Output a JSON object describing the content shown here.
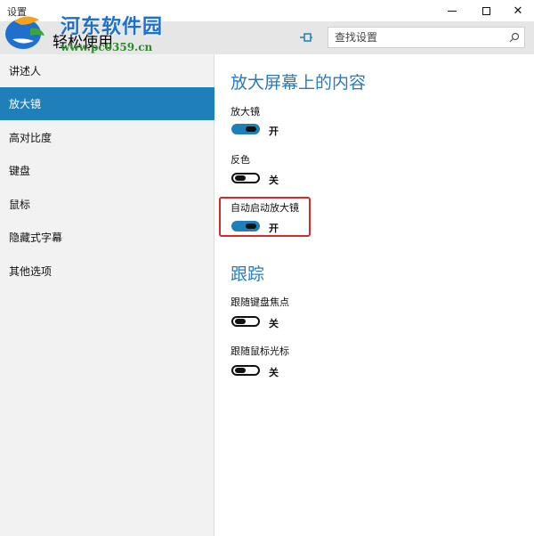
{
  "window": {
    "title": "设置",
    "controls": {
      "minimize": "minimize",
      "maximize": "maximize",
      "close": "close"
    }
  },
  "logo": {
    "text": "河东软件园",
    "url": "www.pc0359.cn"
  },
  "header": {
    "title": "轻松使用",
    "search_placeholder": "查找设置"
  },
  "sidebar": {
    "items": [
      {
        "label": "讲述人",
        "active": false
      },
      {
        "label": "放大镜",
        "active": true
      },
      {
        "label": "高对比度",
        "active": false
      },
      {
        "label": "键盘",
        "active": false
      },
      {
        "label": "鼠标",
        "active": false
      },
      {
        "label": "隐藏式字幕",
        "active": false
      },
      {
        "label": "其他选项",
        "active": false
      }
    ]
  },
  "magnifier_section": {
    "title": "放大屏幕上的内容",
    "settings": [
      {
        "label": "放大镜",
        "state": "开",
        "on": true
      },
      {
        "label": "反色",
        "state": "关",
        "on": false
      },
      {
        "label": "自动启动放大镜",
        "state": "开",
        "on": true
      }
    ]
  },
  "tracking_section": {
    "title": "跟踪",
    "settings": [
      {
        "label": "跟随键盘焦点",
        "state": "关",
        "on": false
      },
      {
        "label": "跟随鼠标光标",
        "state": "关",
        "on": false
      }
    ]
  },
  "colors": {
    "accent": "#1f7fb9",
    "section_title": "#2b7ab8",
    "highlight": "#d42a2a"
  }
}
